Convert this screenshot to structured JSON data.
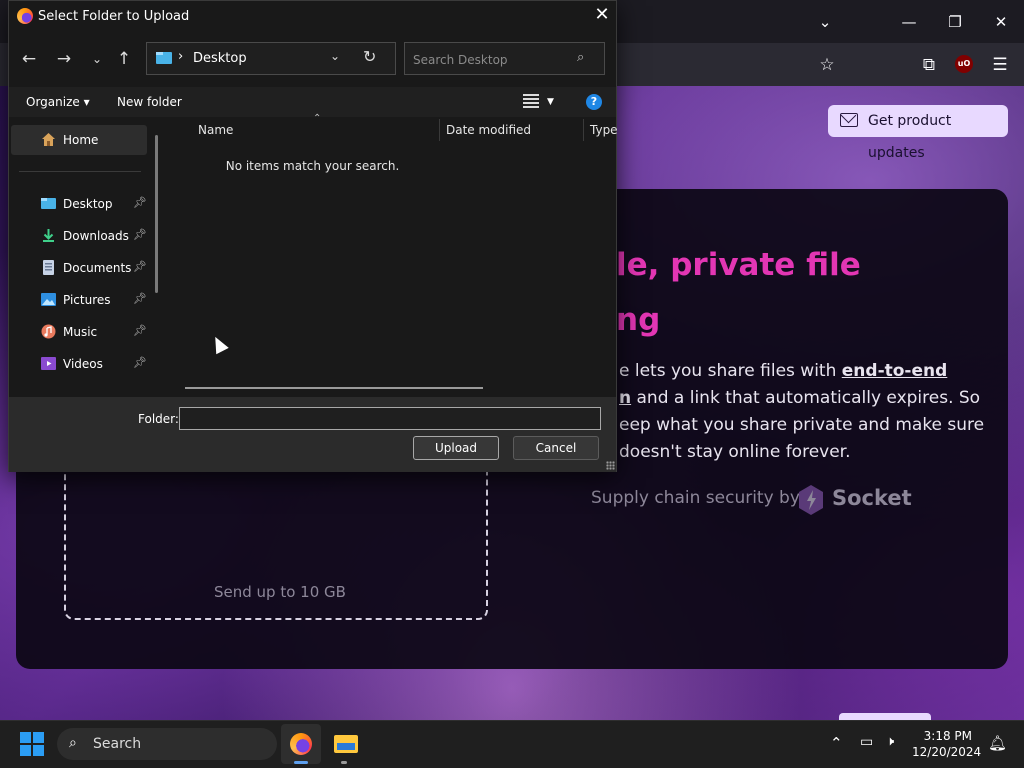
{
  "dialog": {
    "title": "Select Folder to Upload",
    "address": "Desktop",
    "search_placeholder": "Search Desktop",
    "organize_label": "Organize ▾",
    "new_folder_label": "New folder",
    "columns": [
      "Name",
      "Date modified",
      "Type"
    ],
    "empty_message": "No items match your search.",
    "sidebar": [
      {
        "label": "Home",
        "icon": "home-icon",
        "pinned": false
      },
      {
        "label": "Desktop",
        "icon": "desktop-folder-icon",
        "pinned": true
      },
      {
        "label": "Downloads",
        "icon": "download-icon",
        "pinned": true
      },
      {
        "label": "Documents",
        "icon": "documents-icon",
        "pinned": true
      },
      {
        "label": "Pictures",
        "icon": "pictures-icon",
        "pinned": true
      },
      {
        "label": "Music",
        "icon": "music-icon",
        "pinned": true
      },
      {
        "label": "Videos",
        "icon": "videos-icon",
        "pinned": true
      }
    ],
    "folder_label": "Folder:",
    "folder_value": "",
    "upload_label": "Upload",
    "cancel_label": "Cancel"
  },
  "page": {
    "updates_button": "Get product updates",
    "headline_line1": "le, private file",
    "headline_line2": "ng",
    "para_line1_pre": "e lets you share files with ",
    "para_line1_bold": "end-to-end",
    "para_line2_bold": "n",
    "para_line2_rest": " and a link that automatically expires. So",
    "para_line3": "eep what you share private and make sure",
    "para_line4": "doesn't stay online forever.",
    "supply_text": "Supply chain security by",
    "socket_brand": "Socket",
    "send_up": "Send up to 10 GB"
  },
  "taskbar": {
    "search_label": "Search",
    "time": "3:18 PM",
    "date": "12/20/2024"
  },
  "colors": {
    "accent": "#e336b4",
    "dialog_bg": "#191919",
    "taskbar_bg": "#1f1f1f"
  }
}
